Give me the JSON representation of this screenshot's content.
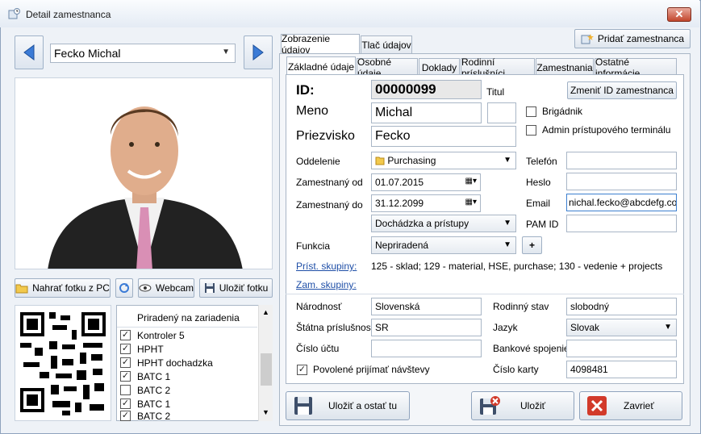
{
  "window": {
    "title": "Detail zamestnanca",
    "close_glyph": "✕"
  },
  "nav": {
    "selected_employee": "Fecko Michal"
  },
  "photo_buttons": {
    "upload": "Nahrať fotku z PC",
    "webcam": "Webcam",
    "save": "Uložiť fotku"
  },
  "devices": {
    "header": "Priradený na zariadenia",
    "items": [
      {
        "label": "Kontroler 5",
        "checked": true,
        "mark": "✓"
      },
      {
        "label": "HPHT",
        "checked": true,
        "mark": "✓"
      },
      {
        "label": "HPHT dochadzka",
        "checked": true,
        "mark": "✓"
      },
      {
        "label": "BATC 1",
        "checked": true,
        "mark": "✓"
      },
      {
        "label": "BATC 2",
        "checked": false,
        "mark": ""
      },
      {
        "label": "BATC 1",
        "checked": true,
        "mark": "✓"
      },
      {
        "label": "BATC 2",
        "checked": true,
        "mark": "✓"
      }
    ]
  },
  "top_tabs": [
    "Zobrazenie údajov",
    "Tlač údajov"
  ],
  "add_employee": "Pridať zamestnanca",
  "sub_tabs": [
    "Základné údaje",
    "Osobné údaje",
    "Doklady",
    "Rodinní príslušníci",
    "Zamestnania",
    "Ostatné informácie"
  ],
  "form": {
    "id_label": "ID:",
    "id_value": "00000099",
    "titul_label": "Titul",
    "titul_value": "",
    "change_id": "Zmeniť ID zamestnanca",
    "meno_label": "Meno",
    "meno_value": "Michal",
    "priezvisko_label": "Priezvisko",
    "priezvisko_value": "Fecko",
    "brigadnik": "Brigádnik",
    "admin": "Admin prístupového terminálu",
    "oddelenie_label": "Oddelenie",
    "oddelenie_value": "Purchasing",
    "od_label": "Zamestnaný od",
    "od_value": "01.07.2015",
    "do_label": "Zamestnaný do",
    "do_value": "31.12.2099",
    "dochadzka_value": "Dochádzka a prístupy",
    "funkcia_label": "Funkcia",
    "funkcia_value": "Nepriradená",
    "plus": "+",
    "telefon_label": "Telefón",
    "telefon_value": "",
    "heslo_label": "Heslo",
    "heslo_value": "",
    "email_label": "Email",
    "email_value": "nichal.fecko@abcdefg.com",
    "pam_label": "PAM ID",
    "pam_value": "",
    "prist_label": "Príst. skupiny:",
    "prist_value": "125 - sklad; 129 - material, HSE, purchase; 130 - vedenie + projects",
    "zam_label": "Zam. skupiny:",
    "narodnost_label": "Národnosť",
    "narodnost_value": "Slovenská",
    "statna_label": "Štátna príslušnosť",
    "statna_value": "SR",
    "ucet_label": "Číslo účtu",
    "ucet_value": "",
    "povolene": "Povolené prijímať návštevy",
    "rodinny_label": "Rodinný stav",
    "rodinny_value": "slobodný",
    "jazyk_label": "Jazyk",
    "jazyk_value": "Slovak",
    "banka_label": "Bankové spojenie",
    "banka_value": "",
    "karta_label": "Číslo karty",
    "karta_value": "4098481"
  },
  "footer": {
    "save_stay": "Uložiť a ostať tu",
    "save": "Uložiť",
    "close": "Zavrieť"
  },
  "colors": {
    "accent": "#3b7bd6",
    "link": "#1f4fa7",
    "close_red": "#c2462c"
  }
}
